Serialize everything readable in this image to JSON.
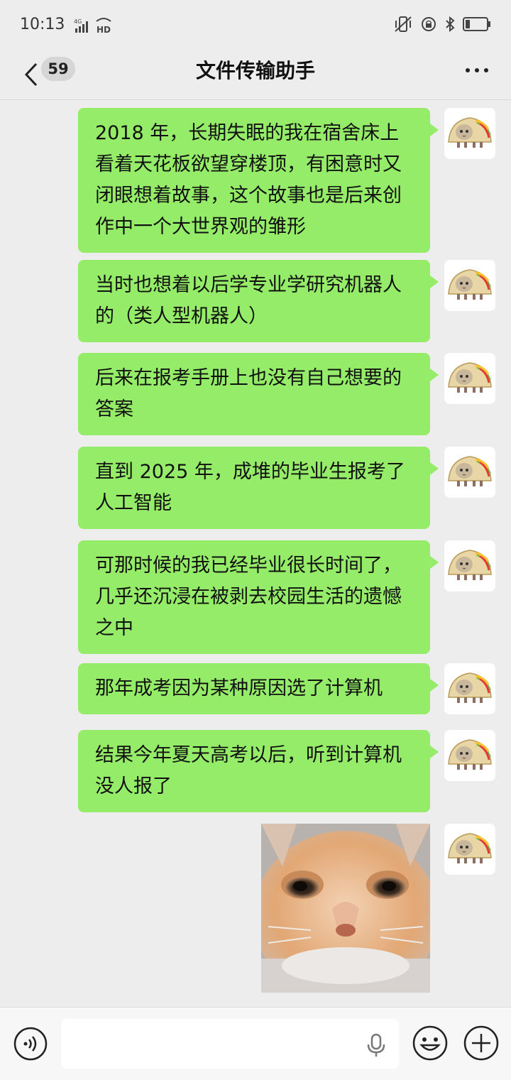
{
  "status_bar": {
    "time": "10:13",
    "network_label": "4G",
    "hd_label": "HD",
    "icons": [
      "signal-icon",
      "wifi-hd-icon",
      "vibrate-mute-icon",
      "alarm-lock-icon",
      "bluetooth-icon",
      "battery-icon"
    ]
  },
  "header": {
    "unread_count": "59",
    "title": "文件传输助手",
    "icons": [
      "chevron-left-icon",
      "more-options-icon"
    ]
  },
  "messages": [
    {
      "text": "2018 年，长期失眠的我在宿舍床上看着天花板欲望穿楼顶，有困意时又闭眼想着故事，这个故事也是后来创作中一个大世界观的雏形"
    },
    {
      "text": "当时也想着以后学专业学研究机器人的（类人型机器人）"
    },
    {
      "text": "后来在报考手册上也没有自己想要的答案"
    },
    {
      "text": "直到 2025 年，成堆的毕业生报考了人工智能"
    },
    {
      "text": "可那时候的我已经毕业很长时间了，几乎还沉浸在被剥去校园生活的遗憾之中"
    },
    {
      "text": "那年成考因为某种原因选了计算机"
    },
    {
      "text": "结果今年夏天高考以后，听到计算机没人报了"
    }
  ],
  "image_message": {
    "content": "cat-face-photo"
  },
  "avatar": {
    "content": "taco-cat-avatar"
  },
  "input_bar": {
    "icons": [
      "voice-mode-icon",
      "microphone-icon",
      "emoji-icon",
      "plus-icon"
    ]
  },
  "colors": {
    "bubble": "#95ec69",
    "background": "#ededed",
    "input_bar": "#f7f7f7"
  }
}
